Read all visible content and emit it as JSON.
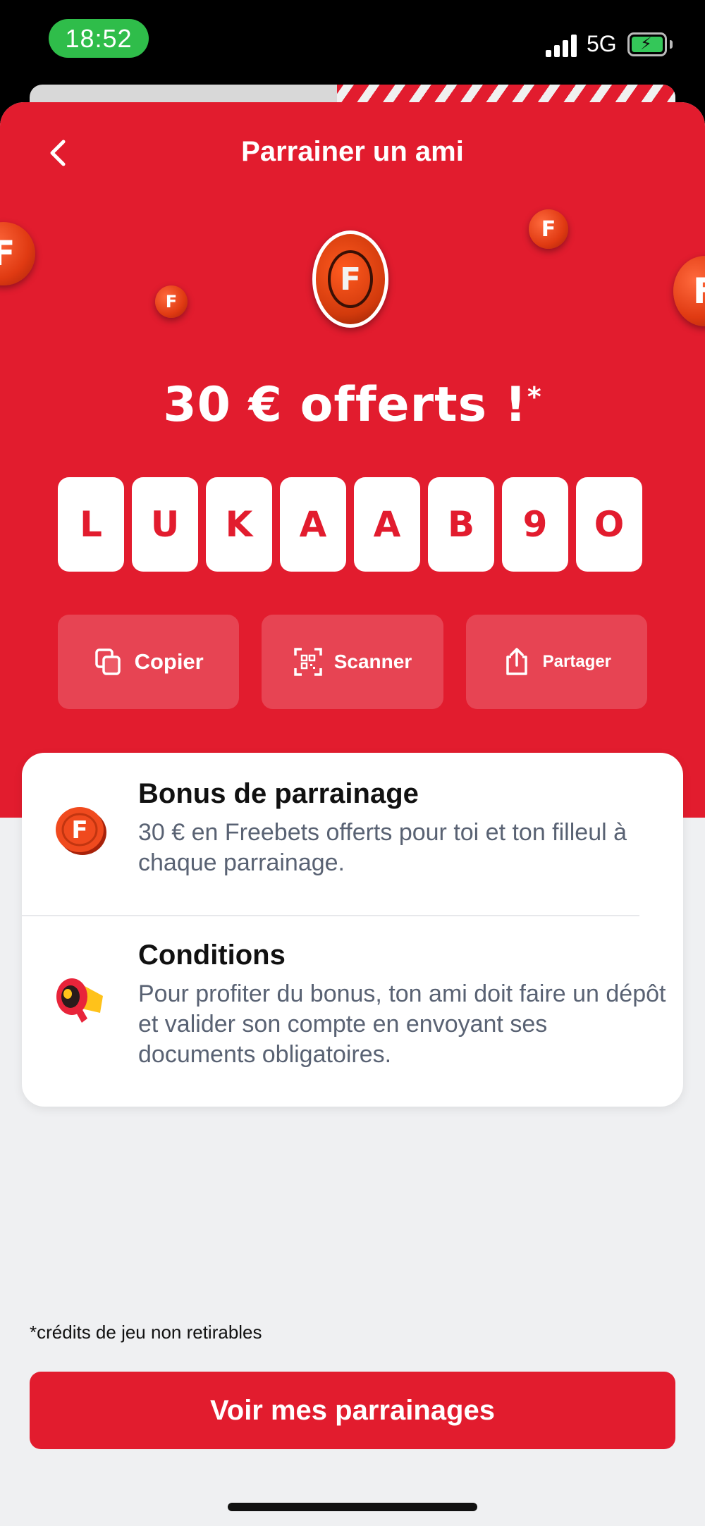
{
  "status_bar": {
    "time": "18:52",
    "network": "5G",
    "battery_icon": "battery-charging-icon"
  },
  "header": {
    "title": "Parrainer un ami",
    "back_icon": "chevron-left-icon"
  },
  "hero": {
    "coin_letter": "F",
    "headline": "30 € offerts !",
    "headline_mark": "*",
    "code": [
      "L",
      "U",
      "K",
      "A",
      "A",
      "B",
      "9",
      "O"
    ]
  },
  "actions": [
    {
      "label": "Copier",
      "icon": "copy-icon"
    },
    {
      "label": "Scanner",
      "icon": "qr-scan-icon"
    },
    {
      "label": "Partager",
      "icon": "share-icon"
    }
  ],
  "info": [
    {
      "title": "Bonus de parrainage",
      "text": "30 € en Freebets offerts pour toi et ton filleul à chaque parrainage.",
      "icon": "coin-icon"
    },
    {
      "title": "Conditions",
      "text": "Pour profiter du bonus, ton ami doit faire un dépôt et valider son compte en envoyant ses documents obligatoires.",
      "icon": "megaphone-icon"
    }
  ],
  "footnote": "*crédits de jeu non retirables",
  "cta": {
    "label": "Voir mes parrainages"
  },
  "colors": {
    "brand_red": "#e21c2e",
    "background": "#eff0f2",
    "muted_text": "#596273"
  }
}
